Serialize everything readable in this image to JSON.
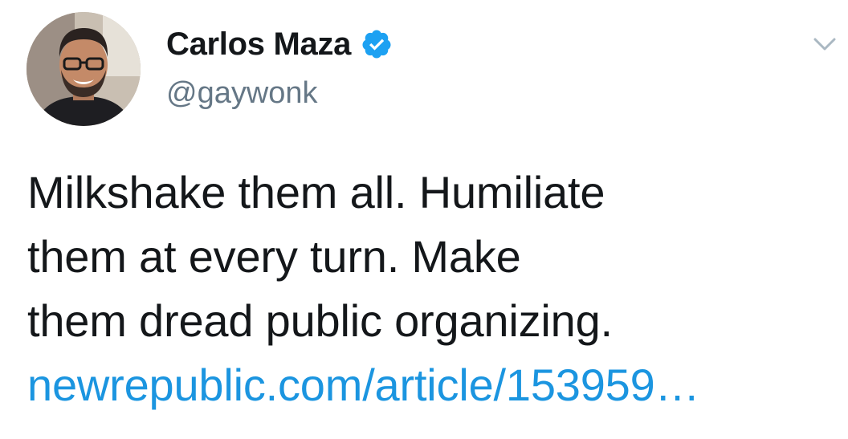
{
  "author": {
    "display_name": "Carlos Maza",
    "handle": "@gaywonk",
    "verified": true,
    "avatar_icon": "profile-photo"
  },
  "tweet": {
    "lines": [
      "Milkshake them all. Humiliate",
      "them at every turn. Make",
      "them dread public organizing."
    ],
    "link_text": "newrepublic.com/article/153959…"
  },
  "icons": {
    "verified": "verified-badge-icon",
    "menu": "chevron-down-icon"
  },
  "colors": {
    "text": "#14171a",
    "handle": "#657786",
    "link": "#1b95e0",
    "verified": "#1da1f2",
    "caret": "#aab8c2"
  }
}
